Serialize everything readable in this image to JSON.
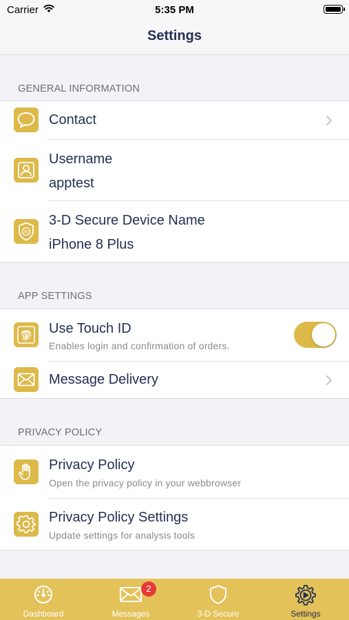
{
  "status_bar": {
    "carrier": "Carrier",
    "time": "5:35 PM"
  },
  "nav": {
    "title": "Settings"
  },
  "sections": {
    "general": {
      "header": "GENERAL INFORMATION",
      "contact": {
        "title": "Contact",
        "icon": "chat-bubble-icon"
      },
      "username": {
        "title": "Username",
        "value": "apptest",
        "icon": "person-icon"
      },
      "device_name": {
        "title": "3-D Secure Device Name",
        "value": "iPhone 8 Plus",
        "icon": "shield-3d-icon"
      }
    },
    "app": {
      "header": "APP SETTINGS",
      "touch_id": {
        "title": "Use Touch ID",
        "subtitle": "Enables login and confirmation of orders.",
        "enabled": true,
        "icon": "fingerprint-icon"
      },
      "message_delivery": {
        "title": "Message Delivery",
        "icon": "envelope-icon"
      }
    },
    "privacy": {
      "header": "PRIVACY POLICY",
      "policy": {
        "title": "Privacy Policy",
        "subtitle": "Open the privacy policy in your webbrowser",
        "icon": "hand-icon"
      },
      "policy_settings": {
        "title": "Privacy Policy Settings",
        "subtitle": "Update settings for analysis tools",
        "icon": "gear-icon"
      }
    }
  },
  "tabs": [
    {
      "label": "Dashboard",
      "icon": "speedometer-icon"
    },
    {
      "label": "Messages",
      "icon": "envelope-icon",
      "badge": "2"
    },
    {
      "label": "3-D Secure",
      "icon": "shield-icon"
    },
    {
      "label": "Settings",
      "icon": "gear-icon",
      "active": true
    }
  ],
  "colors": {
    "accent": "#ddb94a",
    "tab_bar": "#e4c25a",
    "text": "#233052",
    "badge": "#e53935"
  }
}
